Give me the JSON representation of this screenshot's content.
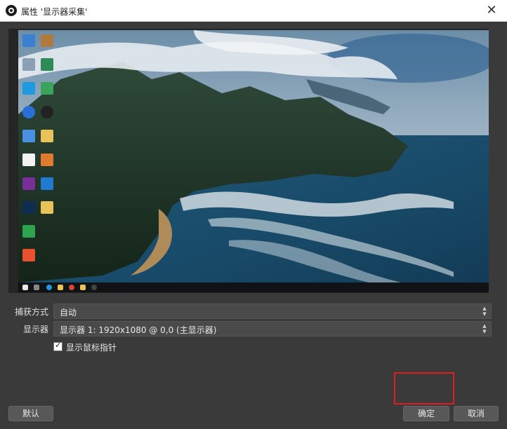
{
  "window": {
    "title": "属性 '显示器采集'"
  },
  "form": {
    "capture_method": {
      "label": "捕获方式",
      "value": "自动"
    },
    "display": {
      "label": "显示器",
      "value": "显示器 1: 1920x1080 @ 0,0 (主显示器)"
    },
    "show_cursor": {
      "label": "显示鼠标指针",
      "checked": true
    }
  },
  "buttons": {
    "defaults": "默认",
    "ok": "确定",
    "cancel": "取消"
  },
  "colors": {
    "highlight": "#e01e1e",
    "window_bg": "#3a3a3a"
  }
}
